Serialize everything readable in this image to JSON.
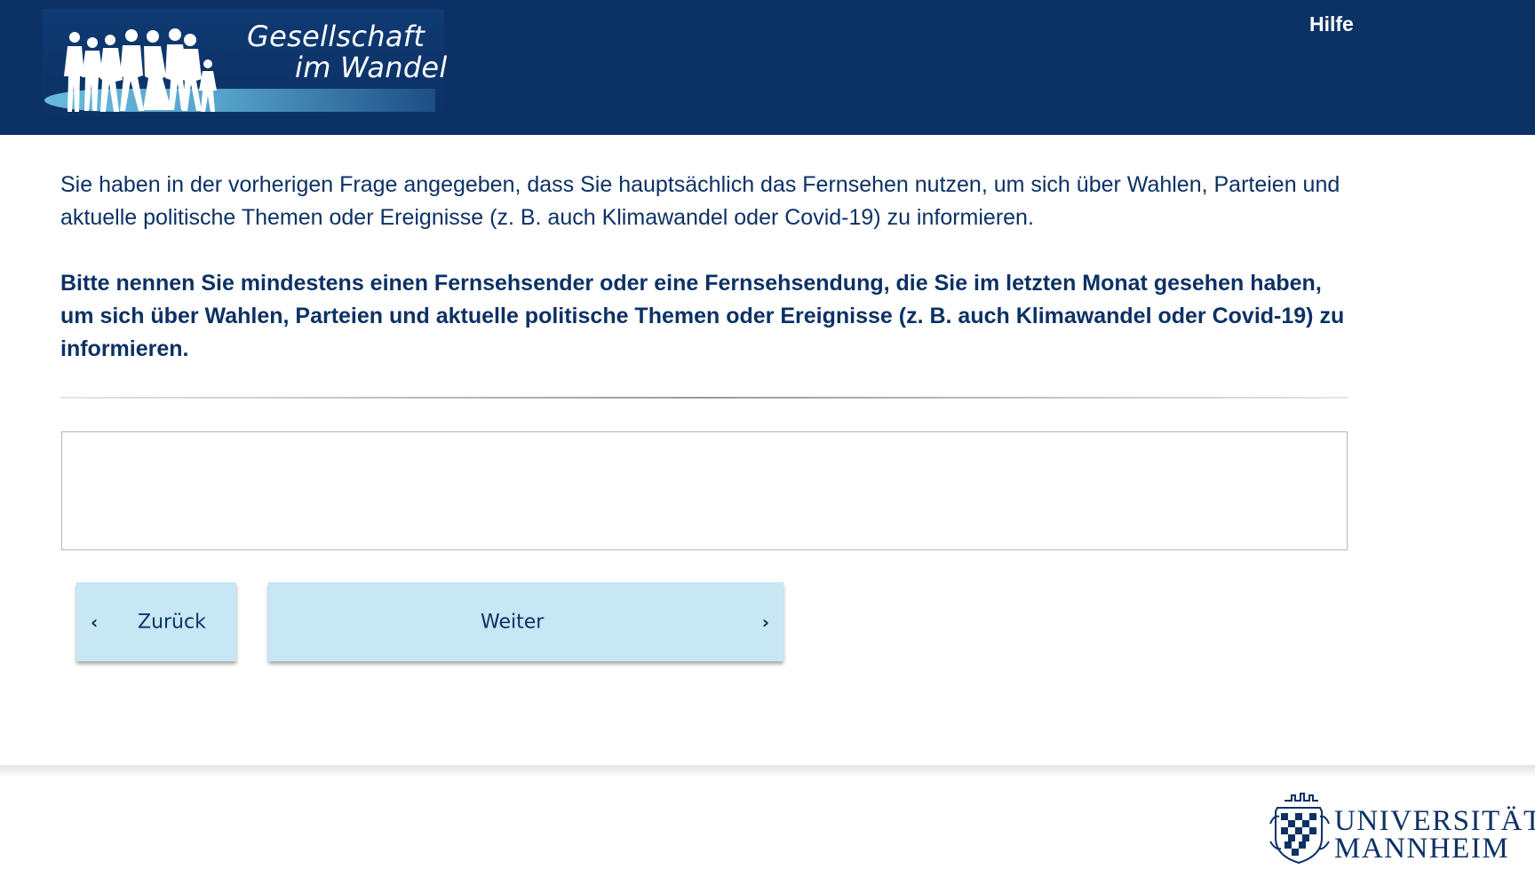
{
  "header": {
    "logo": {
      "line1": "Gesellschaft",
      "line2": "im Wandel",
      "icon": "family-silhouette-logo"
    },
    "help_label": "Hilfe"
  },
  "main": {
    "intro_text": "Sie haben in der vorherigen Frage angegeben, dass Sie hauptsächlich das Fernsehen nutzen, um sich über Wahlen, Parteien und aktuelle politische Themen oder Ereignisse (z. B. auch Klimawandel oder Covid-19) zu informieren.",
    "question_text": "Bitte nennen Sie mindestens einen Fernsehsender oder eine Fernsehsendung, die Sie im letzten Monat gesehen haben, um sich über Wahlen, Parteien und aktuelle politische Themen oder Ereignisse (z. B. auch Klimawandel oder Covid-19) zu informieren.",
    "answer_value": ""
  },
  "navigation": {
    "back_label": "Zurück",
    "back_icon": "‹",
    "next_label": "Weiter",
    "next_icon": "›"
  },
  "footer": {
    "university_line1": "UNIVERSITÄT",
    "university_line2": "MANNHEIM",
    "crest_icon": "university-crest-icon"
  },
  "colors": {
    "header_bg": "#0c3165",
    "text_primary": "#0c3165",
    "button_bg": "#c6e7f3"
  }
}
